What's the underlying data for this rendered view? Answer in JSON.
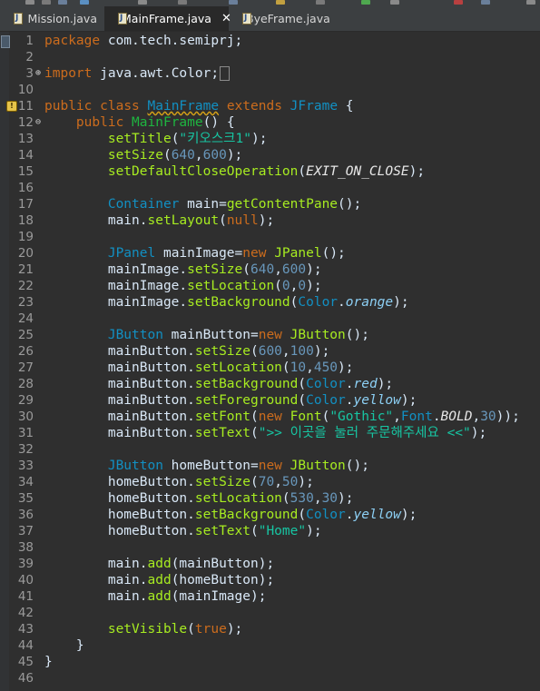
{
  "tabs": [
    {
      "label": "Mission.java",
      "active": false,
      "closable": false
    },
    {
      "label": "MainFrame.java",
      "active": true,
      "closable": true
    },
    {
      "label": "ByeFrame.java",
      "active": false,
      "closable": false
    }
  ],
  "close_glyph": "✕",
  "fold_glyphs": {
    "expanded": "⊖",
    "collapsed": "⊕"
  },
  "colors": {
    "keyword": "#cc6c1d",
    "class": "#1290c3",
    "field": "#8dd0f5",
    "string": "#17c6a3",
    "number": "#6897bb",
    "method": "#a7ec21",
    "method_decl": "#1eb540",
    "text": "#d9e8f7",
    "background": "#2f2f2f"
  },
  "lines": [
    {
      "n": "1",
      "t": [
        [
          "kw",
          "package"
        ],
        [
          "txt",
          " com.tech.semiprj;"
        ]
      ]
    },
    {
      "n": "2",
      "t": []
    },
    {
      "n": "3",
      "fold": "collapsed",
      "box": true,
      "t": [
        [
          "kw",
          "import"
        ],
        [
          "txt",
          " java.awt.Color;"
        ]
      ]
    },
    {
      "n": "10",
      "t": []
    },
    {
      "n": "11",
      "warn": true,
      "t": [
        [
          "kw",
          "public"
        ],
        [
          "txt",
          " "
        ],
        [
          "kw",
          "class"
        ],
        [
          "txt",
          " "
        ],
        [
          "cls",
          "MainFrame",
          "warn-under"
        ],
        [
          "txt",
          " "
        ],
        [
          "kw",
          "extends"
        ],
        [
          "txt",
          " "
        ],
        [
          "cls",
          "JFrame"
        ],
        [
          "txt",
          " {"
        ]
      ]
    },
    {
      "n": "12",
      "fold": "expanded",
      "t": [
        [
          "txt",
          "    "
        ],
        [
          "kw",
          "public"
        ],
        [
          "txt",
          " "
        ],
        [
          "mname",
          "MainFrame"
        ],
        [
          "txt",
          "() {"
        ]
      ]
    },
    {
      "n": "13",
      "t": [
        [
          "txt",
          "        "
        ],
        [
          "mth",
          "setTitle"
        ],
        [
          "txt",
          "("
        ],
        [
          "str",
          "\"키오스크1\""
        ],
        [
          "txt",
          ");"
        ]
      ]
    },
    {
      "n": "14",
      "t": [
        [
          "txt",
          "        "
        ],
        [
          "mth",
          "setSize"
        ],
        [
          "txt",
          "("
        ],
        [
          "num",
          "640"
        ],
        [
          "txt",
          ","
        ],
        [
          "num",
          "600"
        ],
        [
          "txt",
          ");"
        ]
      ]
    },
    {
      "n": "15",
      "t": [
        [
          "txt",
          "        "
        ],
        [
          "mth",
          "setDefaultCloseOperation"
        ],
        [
          "txt",
          "("
        ],
        [
          "itf",
          "EXIT_ON_CLOSE"
        ],
        [
          "txt",
          ");"
        ]
      ]
    },
    {
      "n": "16",
      "t": []
    },
    {
      "n": "17",
      "t": [
        [
          "txt",
          "        "
        ],
        [
          "cls",
          "Container"
        ],
        [
          "txt",
          " "
        ],
        [
          "txt",
          "main"
        ],
        [
          "txt",
          "="
        ],
        [
          "mth",
          "getContentPane"
        ],
        [
          "txt",
          "();"
        ]
      ]
    },
    {
      "n": "18",
      "t": [
        [
          "txt",
          "        main."
        ],
        [
          "mth",
          "setLayout"
        ],
        [
          "txt",
          "("
        ],
        [
          "kw",
          "null"
        ],
        [
          "txt",
          ");"
        ]
      ]
    },
    {
      "n": "19",
      "t": []
    },
    {
      "n": "20",
      "t": [
        [
          "txt",
          "        "
        ],
        [
          "cls",
          "JPanel"
        ],
        [
          "txt",
          " mainImage="
        ],
        [
          "kw",
          "new"
        ],
        [
          "txt",
          " "
        ],
        [
          "mth",
          "JPanel"
        ],
        [
          "txt",
          "();"
        ]
      ]
    },
    {
      "n": "21",
      "t": [
        [
          "txt",
          "        mainImage."
        ],
        [
          "mth",
          "setSize"
        ],
        [
          "txt",
          "("
        ],
        [
          "num",
          "640"
        ],
        [
          "txt",
          ","
        ],
        [
          "num",
          "600"
        ],
        [
          "txt",
          ");"
        ]
      ]
    },
    {
      "n": "22",
      "t": [
        [
          "txt",
          "        mainImage."
        ],
        [
          "mth",
          "setLocation"
        ],
        [
          "txt",
          "("
        ],
        [
          "num",
          "0"
        ],
        [
          "txt",
          ","
        ],
        [
          "num",
          "0"
        ],
        [
          "txt",
          ");"
        ]
      ]
    },
    {
      "n": "23",
      "t": [
        [
          "txt",
          "        mainImage."
        ],
        [
          "mth",
          "setBackground"
        ],
        [
          "txt",
          "("
        ],
        [
          "cls",
          "Color"
        ],
        [
          "txt",
          "."
        ],
        [
          "cst",
          "orange"
        ],
        [
          "txt",
          ");"
        ]
      ]
    },
    {
      "n": "24",
      "t": []
    },
    {
      "n": "25",
      "t": [
        [
          "txt",
          "        "
        ],
        [
          "cls",
          "JButton"
        ],
        [
          "txt",
          " mainButton="
        ],
        [
          "kw",
          "new"
        ],
        [
          "txt",
          " "
        ],
        [
          "mth",
          "JButton"
        ],
        [
          "txt",
          "();"
        ]
      ]
    },
    {
      "n": "26",
      "t": [
        [
          "txt",
          "        mainButton."
        ],
        [
          "mth",
          "setSize"
        ],
        [
          "txt",
          "("
        ],
        [
          "num",
          "600"
        ],
        [
          "txt",
          ","
        ],
        [
          "num",
          "100"
        ],
        [
          "txt",
          ");"
        ]
      ]
    },
    {
      "n": "27",
      "t": [
        [
          "txt",
          "        mainButton."
        ],
        [
          "mth",
          "setLocation"
        ],
        [
          "txt",
          "("
        ],
        [
          "num",
          "10"
        ],
        [
          "txt",
          ","
        ],
        [
          "num",
          "450"
        ],
        [
          "txt",
          ");"
        ]
      ]
    },
    {
      "n": "28",
      "t": [
        [
          "txt",
          "        mainButton."
        ],
        [
          "mth",
          "setBackground"
        ],
        [
          "txt",
          "("
        ],
        [
          "cls",
          "Color"
        ],
        [
          "txt",
          "."
        ],
        [
          "cst",
          "red"
        ],
        [
          "txt",
          ");"
        ]
      ]
    },
    {
      "n": "29",
      "t": [
        [
          "txt",
          "        mainButton."
        ],
        [
          "mth",
          "setForeground"
        ],
        [
          "txt",
          "("
        ],
        [
          "cls",
          "Color"
        ],
        [
          "txt",
          "."
        ],
        [
          "cst",
          "yellow"
        ],
        [
          "txt",
          ");"
        ]
      ]
    },
    {
      "n": "30",
      "t": [
        [
          "txt",
          "        mainButton."
        ],
        [
          "mth",
          "setFont"
        ],
        [
          "txt",
          "("
        ],
        [
          "kw",
          "new"
        ],
        [
          "txt",
          " "
        ],
        [
          "mth",
          "Font"
        ],
        [
          "txt",
          "("
        ],
        [
          "str",
          "\"Gothic\""
        ],
        [
          "txt",
          ","
        ],
        [
          "cls",
          "Font"
        ],
        [
          "txt",
          "."
        ],
        [
          "itf",
          "BOLD"
        ],
        [
          "txt",
          ","
        ],
        [
          "num",
          "30"
        ],
        [
          "txt",
          "));"
        ]
      ]
    },
    {
      "n": "31",
      "t": [
        [
          "txt",
          "        mainButton."
        ],
        [
          "mth",
          "setText"
        ],
        [
          "txt",
          "("
        ],
        [
          "str",
          "\">> 이곳을 눌러 주문해주세요 <<\""
        ],
        [
          "txt",
          ");"
        ]
      ]
    },
    {
      "n": "32",
      "t": []
    },
    {
      "n": "33",
      "t": [
        [
          "txt",
          "        "
        ],
        [
          "cls",
          "JButton"
        ],
        [
          "txt",
          " homeButton="
        ],
        [
          "kw",
          "new"
        ],
        [
          "txt",
          " "
        ],
        [
          "mth",
          "JButton"
        ],
        [
          "txt",
          "();"
        ]
      ]
    },
    {
      "n": "34",
      "t": [
        [
          "txt",
          "        homeButton."
        ],
        [
          "mth",
          "setSize"
        ],
        [
          "txt",
          "("
        ],
        [
          "num",
          "70"
        ],
        [
          "txt",
          ","
        ],
        [
          "num",
          "50"
        ],
        [
          "txt",
          ");"
        ]
      ]
    },
    {
      "n": "35",
      "t": [
        [
          "txt",
          "        homeButton."
        ],
        [
          "mth",
          "setLocation"
        ],
        [
          "txt",
          "("
        ],
        [
          "num",
          "530"
        ],
        [
          "txt",
          ","
        ],
        [
          "num",
          "30"
        ],
        [
          "txt",
          ");"
        ]
      ]
    },
    {
      "n": "36",
      "t": [
        [
          "txt",
          "        homeButton."
        ],
        [
          "mth",
          "setBackground"
        ],
        [
          "txt",
          "("
        ],
        [
          "cls",
          "Color"
        ],
        [
          "txt",
          "."
        ],
        [
          "cst",
          "yellow"
        ],
        [
          "txt",
          ");"
        ]
      ]
    },
    {
      "n": "37",
      "t": [
        [
          "txt",
          "        homeButton."
        ],
        [
          "mth",
          "setText"
        ],
        [
          "txt",
          "("
        ],
        [
          "str",
          "\"Home\""
        ],
        [
          "txt",
          ");"
        ]
      ]
    },
    {
      "n": "38",
      "t": []
    },
    {
      "n": "39",
      "t": [
        [
          "txt",
          "        main."
        ],
        [
          "mth",
          "add"
        ],
        [
          "txt",
          "(mainButton);"
        ]
      ]
    },
    {
      "n": "40",
      "t": [
        [
          "txt",
          "        main."
        ],
        [
          "mth",
          "add"
        ],
        [
          "txt",
          "(homeButton);"
        ]
      ]
    },
    {
      "n": "41",
      "t": [
        [
          "txt",
          "        main."
        ],
        [
          "mth",
          "add"
        ],
        [
          "txt",
          "(mainImage);"
        ]
      ]
    },
    {
      "n": "42",
      "t": []
    },
    {
      "n": "43",
      "t": [
        [
          "txt",
          "        "
        ],
        [
          "mth",
          "setVisible"
        ],
        [
          "txt",
          "("
        ],
        [
          "kw",
          "true"
        ],
        [
          "txt",
          ");"
        ]
      ]
    },
    {
      "n": "44",
      "t": [
        [
          "txt",
          "    }"
        ]
      ]
    },
    {
      "n": "45",
      "t": [
        [
          "txt",
          "}"
        ]
      ]
    },
    {
      "n": "46",
      "t": []
    }
  ]
}
